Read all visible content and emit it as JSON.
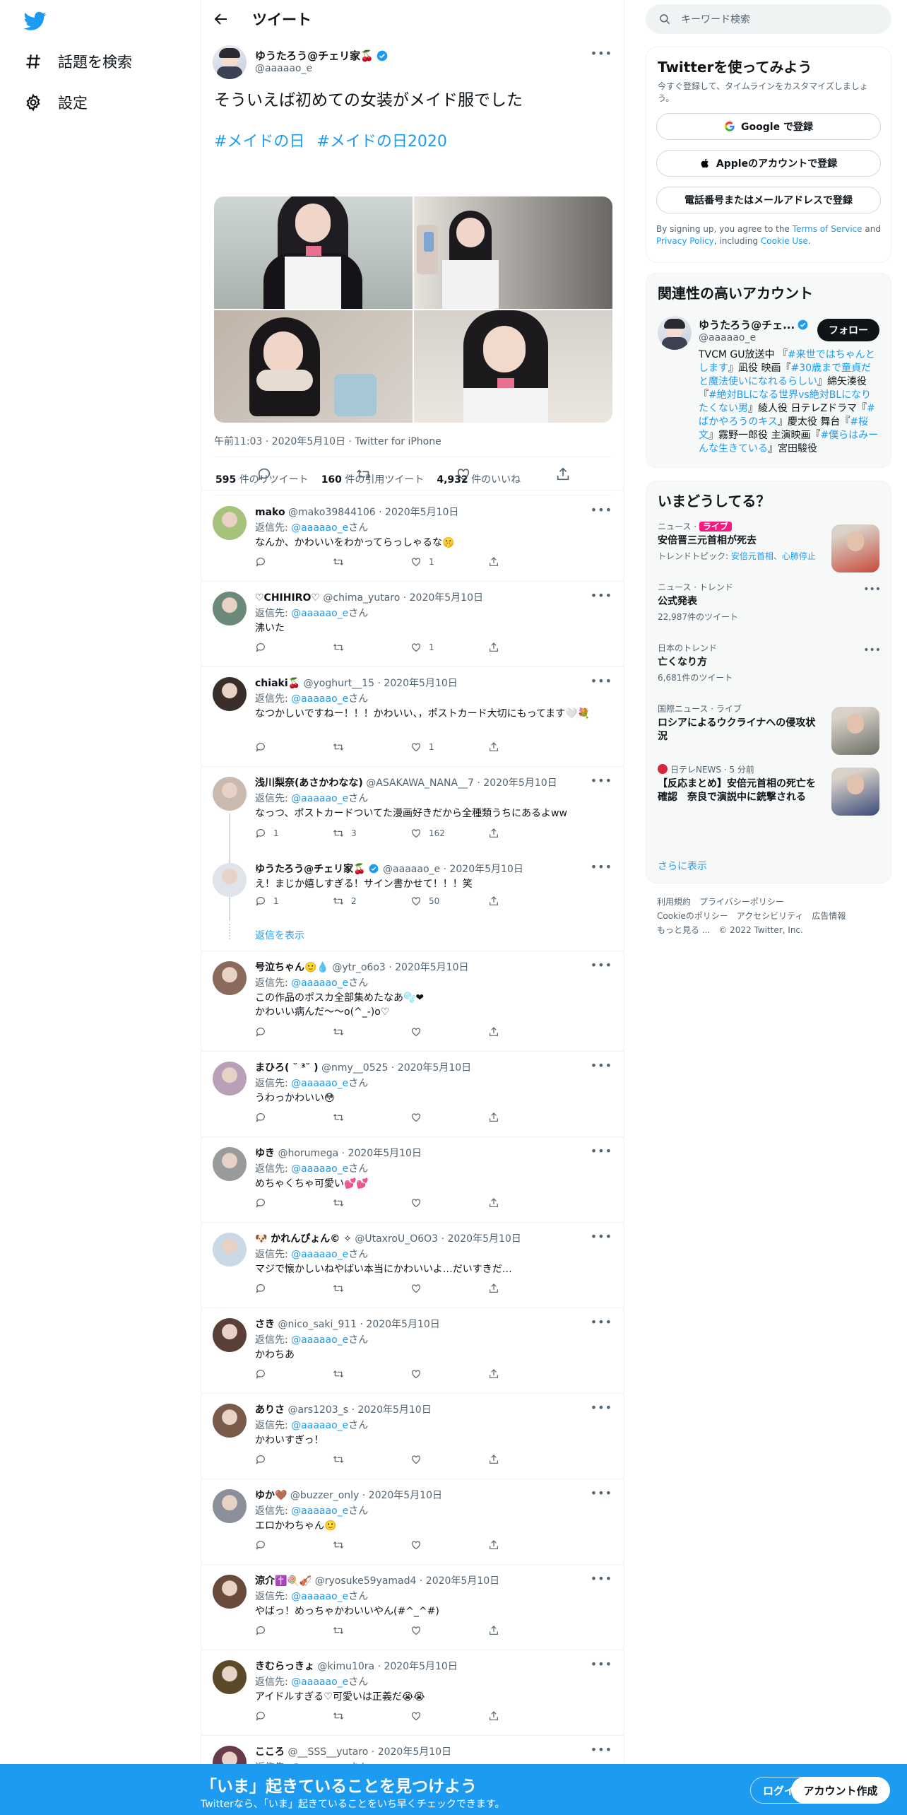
{
  "left_nav": {
    "items": [
      {
        "label": "話題を検索",
        "icon": "hashtag-icon"
      },
      {
        "label": "設定",
        "icon": "gear-icon"
      }
    ]
  },
  "header": {
    "title": "ツイート"
  },
  "tweet": {
    "name": "ゆうたろう@チェリ家🍒",
    "handle": "@aaaaao_e",
    "text": "そういえば初めての女装がメイド服でした",
    "tags": "#メイドの日 #メイドの日2020",
    "time": "午前11:03 · 2020年5月10日 · Twitter for iPhone",
    "retweets": "595",
    "retweets_label": "件のリツイート",
    "quotes": "160",
    "quotes_label": "件の引用ツイート",
    "likes": "4,932",
    "likes_label": "件のいいね"
  },
  "replying_label": "返信先:",
  "replying_to": "@aaaaao_e",
  "replying_suffix": "さん",
  "show_replies": "返信を表示",
  "replies": [
    {
      "name": "mako",
      "handle": "@mako39844106 · 2020年5月10日",
      "text": "なんか、かわいいをわかってらっしゃるな🤫",
      "reply": "",
      "rt": "",
      "like": "1",
      "av": "#a7c27a"
    },
    {
      "name": "♡CHIHIRO♡",
      "handle": "@chima_yutaro · 2020年5月10日",
      "text": "沸いた",
      "reply": "",
      "rt": "",
      "like": "1",
      "av": "#6b8a7a"
    },
    {
      "name": "chiaki🍒",
      "handle": "@yoghurt__15 · 2020年5月10日",
      "text": "なつかしいですねー！！！かわいい、，ポストカード大切にもってます🤍💐",
      "reply": "",
      "rt": "",
      "like": "1",
      "av": "#3a2e2a"
    },
    {
      "name": "浅川梨奈(あさかわなな)",
      "handle": "@ASAKAWA_NANA__7 · 2020年5月10日",
      "text": "なっつ、ポストカードついてた漫画好きだから全種類うちにあるよww",
      "reply": "1",
      "rt": "3",
      "like": "162",
      "av": "#c9b9ae"
    },
    {
      "name": "ゆうたろう@チェリ家🍒",
      "handle": "@aaaaao_e · 2020年5月10日",
      "text": "え！まじか嬉しすぎる！サイン書かせて！！！笑",
      "reply": "1",
      "rt": "2",
      "like": "50",
      "av": "#dfe3ea",
      "noto": true
    },
    {
      "name": "号泣ちゃん🙂💧",
      "handle": "@ytr_o6o3 · 2020年5月10日",
      "text": "この作品のポスカ全部集めたなあ🫧❤\nかわいい病んだ〜〜o(^_-)o♡",
      "reply": "",
      "rt": "",
      "like": "",
      "av": "#8a6a5a"
    },
    {
      "name": "まひろ( ˘ ³˘ )",
      "handle": "@nmy__0525 · 2020年5月10日",
      "text": "うわっかわいい😳",
      "reply": "",
      "rt": "",
      "like": "",
      "av": "#b7a0b8"
    },
    {
      "name": "ゆき",
      "handle": "@horumega · 2020年5月10日",
      "text": "めちゃくちゃ可愛い💕💕",
      "reply": "",
      "rt": "",
      "like": "",
      "av": "#9a9a9a"
    },
    {
      "name": "🐶 かれんぴょん© ✧",
      "handle": "@UtaxroU_O6O3 · 2020年5月10日",
      "text": "マジで懐かしいねやばい本当にかわいいよ…だいすきだ…",
      "reply": "",
      "rt": "",
      "like": "",
      "av": "#c8d8e4"
    },
    {
      "name": "さき",
      "handle": "@nico_saki_911 · 2020年5月10日",
      "text": "かわちあ",
      "reply": "",
      "rt": "",
      "like": "",
      "av": "#5a3e38"
    },
    {
      "name": "ありさ",
      "handle": "@ars1203_s · 2020年5月10日",
      "text": "かわいすぎっ！",
      "reply": "",
      "rt": "",
      "like": "",
      "av": "#7a5a48"
    },
    {
      "name": "ゆか🤎",
      "handle": "@buzzer_only · 2020年5月10日",
      "text": "エロかわちゃん🙂",
      "reply": "",
      "rt": "",
      "like": "",
      "av": "#8a8f9a"
    },
    {
      "name": "涼介✝️🍭🎻",
      "handle": "@ryosuke59yamad4 · 2020年5月10日",
      "text": "やばっ！めっちゃかわいいやん(#^_^#)",
      "reply": "",
      "rt": "",
      "like": "",
      "av": "#6a4a3a"
    },
    {
      "name": "きむらっきょ",
      "handle": "@kimu10ra · 2020年5月10日",
      "text": "アイドルすぎる♡可愛いは正義だ😭😭",
      "reply": "",
      "rt": "",
      "like": "",
      "av": "#5a4a2a"
    },
    {
      "name": "こころ",
      "handle": "@__SSS__yutaro · 2020年5月10日",
      "text": "",
      "reply": "",
      "rt": "",
      "like": "",
      "av": "#6a3a4a"
    }
  ],
  "search": {
    "placeholder": "キーワード検索"
  },
  "signup": {
    "title": "Twitterを使ってみよう",
    "desc": "今すぐ登録して、タイムラインをカスタマイズしましょう。",
    "google": "Google で登録",
    "apple": "Appleのアカウントで登録",
    "phone": "電話番号またはメールアドレスで登録",
    "legal_1": "By signing up, you agree to the",
    "terms": "Terms of Service",
    "legal_2": "and",
    "privacy": "Privacy Policy",
    "legal_3": ", including",
    "cookie": "Cookie Use",
    "legal_4": "."
  },
  "related": {
    "title": "関連性の高いアカウント",
    "name": "ゆうたろう@チェ...",
    "handle": "@aaaaao_e",
    "follow": "フォロー",
    "bio_parts": [
      {
        "t": "TVCM GU放送中 『",
        "l": false
      },
      {
        "t": "#来世ではちゃんとします",
        "l": true
      },
      {
        "t": "』凪役 映画『",
        "l": false
      },
      {
        "t": "#30歳まで童貞だと魔法使いになれるらしい",
        "l": true
      },
      {
        "t": "』綿矢湊役『",
        "l": false
      },
      {
        "t": "#絶対BLになる世界vs絶対BLになりたくない男",
        "l": true
      },
      {
        "t": "』綾人役 日テレZドラマ『",
        "l": false
      },
      {
        "t": "#ばかやろうのキス",
        "l": true
      },
      {
        "t": "』慶太役 舞台『",
        "l": false
      },
      {
        "t": "#桜文",
        "l": true
      },
      {
        "t": "』霧野一郎役 主演映画『",
        "l": false
      },
      {
        "t": "#僕らはみーんな生きている",
        "l": true
      },
      {
        "t": "』宮田駿役",
        "l": false
      }
    ]
  },
  "trends": {
    "title": "いまどうしてる？",
    "items": [
      {
        "cat": "ニュース · ",
        "badge": "ライブ",
        "title": "安倍晋三元首相が死去",
        "sub_label": "トレンドトピック: ",
        "sub_link": "安倍元首相、心肺停止",
        "thumb": true
      },
      {
        "cat": "ニュース · トレンド",
        "badge": "",
        "title": "公式発表",
        "sub_label": "22,987件のツイート",
        "sub_link": "",
        "thumb": false
      },
      {
        "cat": "日本のトレンド",
        "badge": "",
        "title": "亡くなり方",
        "sub_label": "6,681件のツイート",
        "sub_link": "",
        "thumb": false
      },
      {
        "cat": "国際ニュース · ライブ",
        "badge": "",
        "title": "ロシアによるウクライナへの侵攻状況",
        "sub_label": "",
        "sub_link": "",
        "thumb": true
      },
      {
        "cat": "日テレNEWS · 5 分前",
        "badge": "",
        "title": "【反応まとめ】安倍元首相の死亡を確認　奈良で演説中に銃撃される",
        "sub_label": "",
        "sub_link": "",
        "thumb": true
      }
    ],
    "more": "さらに表示"
  },
  "footer_links": {
    "line1": "利用規約　プライバシーポリシー",
    "line2": "Cookieのポリシー　アクセシビリティ　広告情報",
    "line3": "もっと見る ...　© 2022 Twitter, Inc."
  },
  "bottom_bar": {
    "title": "「いま」起きていることを見つけよう",
    "sub": "Twitterなら、「いま」起きていることをいち早くチェックできます。",
    "login": "ログイン",
    "signup": "アカウント作成"
  },
  "colors": {
    "accent": "#1d9bf0",
    "live": "#f91880"
  }
}
